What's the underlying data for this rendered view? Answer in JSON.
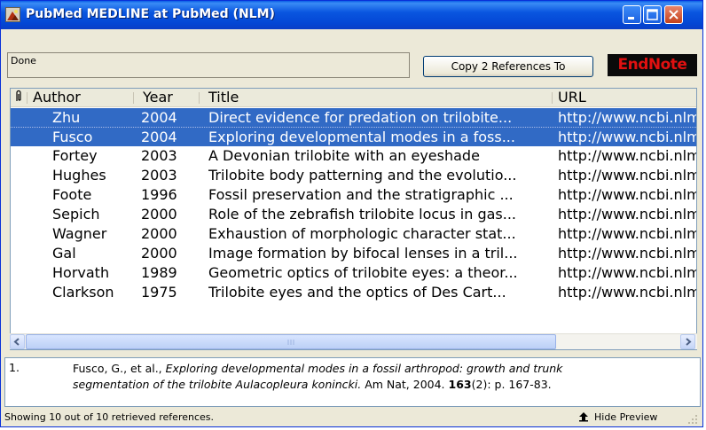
{
  "window": {
    "title": "PubMed MEDLINE at PubMed (NLM)"
  },
  "toolbar": {
    "status_text": "Done",
    "copy_button_label": "Copy 2 References To",
    "logo_text": "EndNote"
  },
  "table": {
    "columns": {
      "attachment_icon": "paperclip",
      "author": "Author",
      "year": "Year",
      "title": "Title",
      "url": "URL"
    },
    "rows": [
      {
        "author": "Zhu",
        "year": "2004",
        "title": "Direct evidence for predation on trilobite...",
        "url": "http://www.ncbi.nlm",
        "selected": true
      },
      {
        "author": "Fusco",
        "year": "2004",
        "title": "Exploring developmental modes in a foss...",
        "url": "http://www.ncbi.nlm",
        "selected": true
      },
      {
        "author": "Fortey",
        "year": "2003",
        "title": "A Devonian trilobite with an eyeshade",
        "url": "http://www.ncbi.nlm",
        "selected": false
      },
      {
        "author": "Hughes",
        "year": "2003",
        "title": "Trilobite body patterning and the evolutio...",
        "url": "http://www.ncbi.nlm",
        "selected": false
      },
      {
        "author": "Foote",
        "year": "1996",
        "title": "Fossil preservation and the stratigraphic ...",
        "url": "http://www.ncbi.nlm",
        "selected": false
      },
      {
        "author": "Sepich",
        "year": "2000",
        "title": "Role of the zebrafish trilobite locus in gas...",
        "url": "http://www.ncbi.nlm",
        "selected": false
      },
      {
        "author": "Wagner",
        "year": "2000",
        "title": "Exhaustion of morphologic character stat...",
        "url": "http://www.ncbi.nlm",
        "selected": false
      },
      {
        "author": "Gal",
        "year": "2000",
        "title": "Image formation by bifocal lenses in a tril...",
        "url": "http://www.ncbi.nlm",
        "selected": false
      },
      {
        "author": "Horvath",
        "year": "1989",
        "title": "Geometric optics of trilobite eyes: a theor...",
        "url": "http://www.ncbi.nlm",
        "selected": false
      },
      {
        "author": "Clarkson",
        "year": "1975",
        "title": "Trilobite eyes and the optics of Des Cart...",
        "url": "http://www.ncbi.nlm",
        "selected": false
      }
    ]
  },
  "preview": {
    "number": "1.",
    "authors": "Fusco, G., et al.,",
    "title_line1": "Exploring developmental modes in a fossil arthropod: growth and trunk",
    "title_line2": "segmentation of the trilobite Aulacopleura konincki.",
    "journal": "Am Nat, 2004.",
    "volume": "163",
    "issue_pages": "(2): p. 167-83."
  },
  "statusbar": {
    "text": "Showing 10 out of 10 retrieved references.",
    "hide_preview_label": "Hide Preview"
  },
  "colors": {
    "selection": "#316ac5",
    "titlebar": "#0a56e0",
    "logo_text": "#e01010"
  }
}
